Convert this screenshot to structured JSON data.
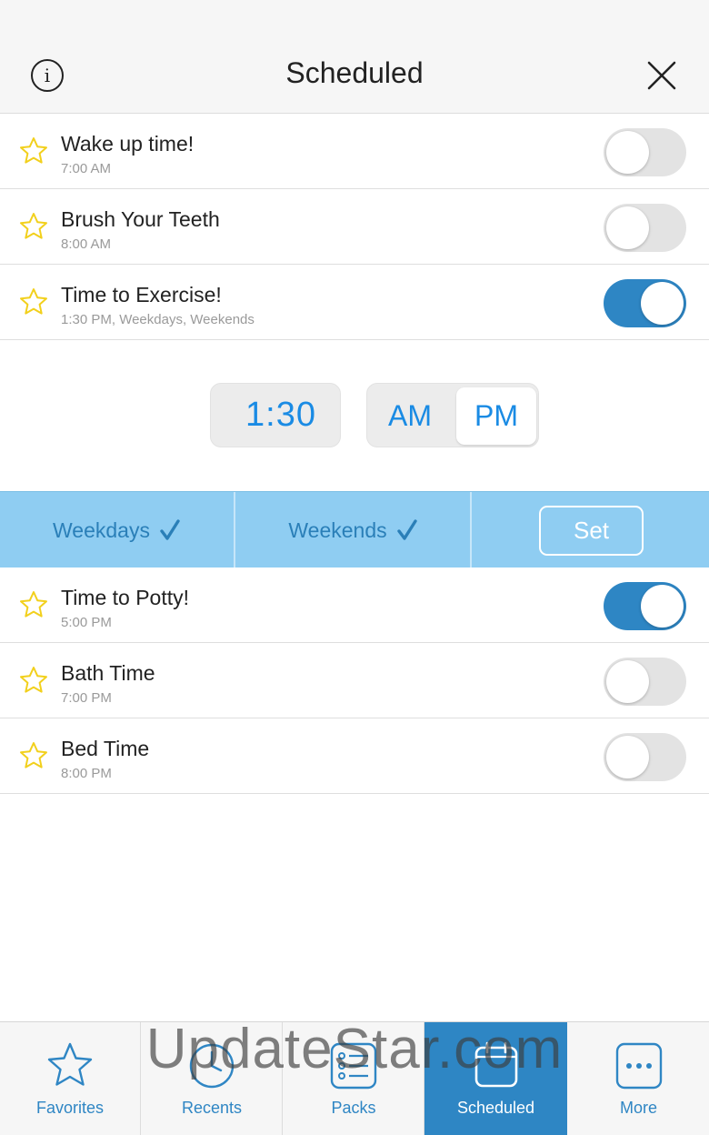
{
  "header": {
    "title": "Scheduled",
    "info_icon": "info-icon",
    "close_icon": "close-icon"
  },
  "schedules_top": [
    {
      "name": "Wake up time!",
      "sub": "7:00 AM",
      "enabled": false
    },
    {
      "name": "Brush Your Teeth",
      "sub": "8:00 AM",
      "enabled": false
    },
    {
      "name": "Time to Exercise!",
      "sub": "1:30 PM, Weekdays, Weekends",
      "enabled": true
    }
  ],
  "picker": {
    "time": "1:30",
    "am_label": "AM",
    "pm_label": "PM",
    "selected": "PM"
  },
  "days": {
    "weekdays_label": "Weekdays",
    "weekends_label": "Weekends",
    "set_label": "Set"
  },
  "schedules_bottom": [
    {
      "name": "Time to Potty!",
      "sub": "5:00 PM",
      "enabled": true
    },
    {
      "name": "Bath Time",
      "sub": "7:00 PM",
      "enabled": false
    },
    {
      "name": "Bed Time",
      "sub": "8:00 PM",
      "enabled": false
    }
  ],
  "tabs": [
    {
      "label": "Favorites",
      "icon": "star-icon",
      "active": false
    },
    {
      "label": "Recents",
      "icon": "clock-icon",
      "active": false
    },
    {
      "label": "Packs",
      "icon": "list-icon",
      "active": false
    },
    {
      "label": "Scheduled",
      "icon": "calendar-icon",
      "active": true
    },
    {
      "label": "More",
      "icon": "ellipsis-icon",
      "active": false
    }
  ],
  "watermark": "UpdateStar.com",
  "colors": {
    "accent": "#2e86c4",
    "days_bar": "#8fcdf2",
    "picker_text": "#1a8be4",
    "star": "#f2d01c"
  }
}
